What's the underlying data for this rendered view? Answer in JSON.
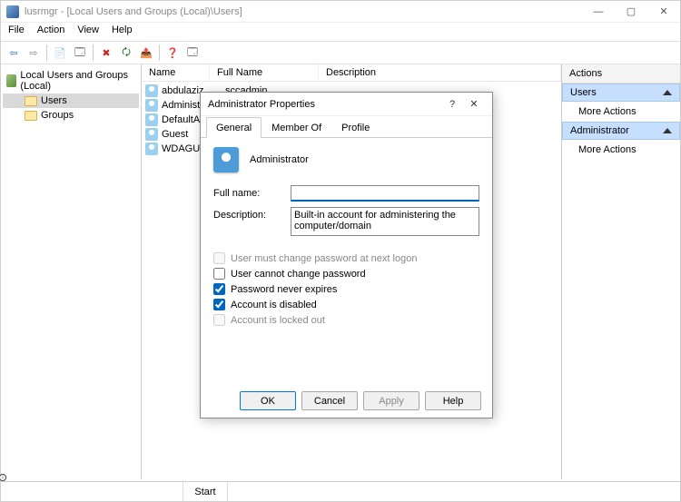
{
  "window": {
    "title": "lusrmgr - [Local Users and Groups (Local)\\Users]",
    "minimize": "—",
    "maximize": "▢",
    "close": "✕"
  },
  "menu": [
    "File",
    "Action",
    "View",
    "Help"
  ],
  "tree": {
    "root": "Local Users and Groups (Local)",
    "items": [
      {
        "label": "Users",
        "selected": true
      },
      {
        "label": "Groups",
        "selected": false
      }
    ]
  },
  "list": {
    "columns": {
      "name": "Name",
      "full": "Full Name",
      "desc": "Description"
    },
    "rows": [
      {
        "name": "abdulaziz",
        "full": "sccadmin",
        "desc": ""
      },
      {
        "name": "Administrat",
        "full": "",
        "desc": ""
      },
      {
        "name": "DefaultAcc",
        "full": "",
        "desc": ""
      },
      {
        "name": "Guest",
        "full": "",
        "desc": ""
      },
      {
        "name": "WDAGUtil",
        "full": "",
        "desc": ""
      }
    ]
  },
  "actions": {
    "header": "Actions",
    "sections": [
      {
        "title": "Users",
        "links": [
          "More Actions"
        ]
      },
      {
        "title": "Administrator",
        "links": [
          "More Actions"
        ]
      }
    ]
  },
  "dialog": {
    "title": "Administrator Properties",
    "help": "?",
    "close": "✕",
    "tabs": [
      "General",
      "Member Of",
      "Profile"
    ],
    "active_tab": 0,
    "heading": "Administrator",
    "full_name_label": "Full name:",
    "full_name_value": "",
    "description_label": "Description:",
    "description_value": "Built-in account for administering the computer/domain",
    "checks": [
      {
        "label": "User must change password at next logon",
        "checked": false,
        "disabled": true
      },
      {
        "label": "User cannot change password",
        "checked": false,
        "disabled": false
      },
      {
        "label": "Password never expires",
        "checked": true,
        "disabled": false
      },
      {
        "label": "Account is disabled",
        "checked": true,
        "disabled": false
      },
      {
        "label": "Account is locked out",
        "checked": false,
        "disabled": true
      }
    ],
    "buttons": {
      "ok": "OK",
      "cancel": "Cancel",
      "apply": "Apply",
      "help": "Help"
    }
  },
  "taskbar": {
    "start": "Start"
  }
}
